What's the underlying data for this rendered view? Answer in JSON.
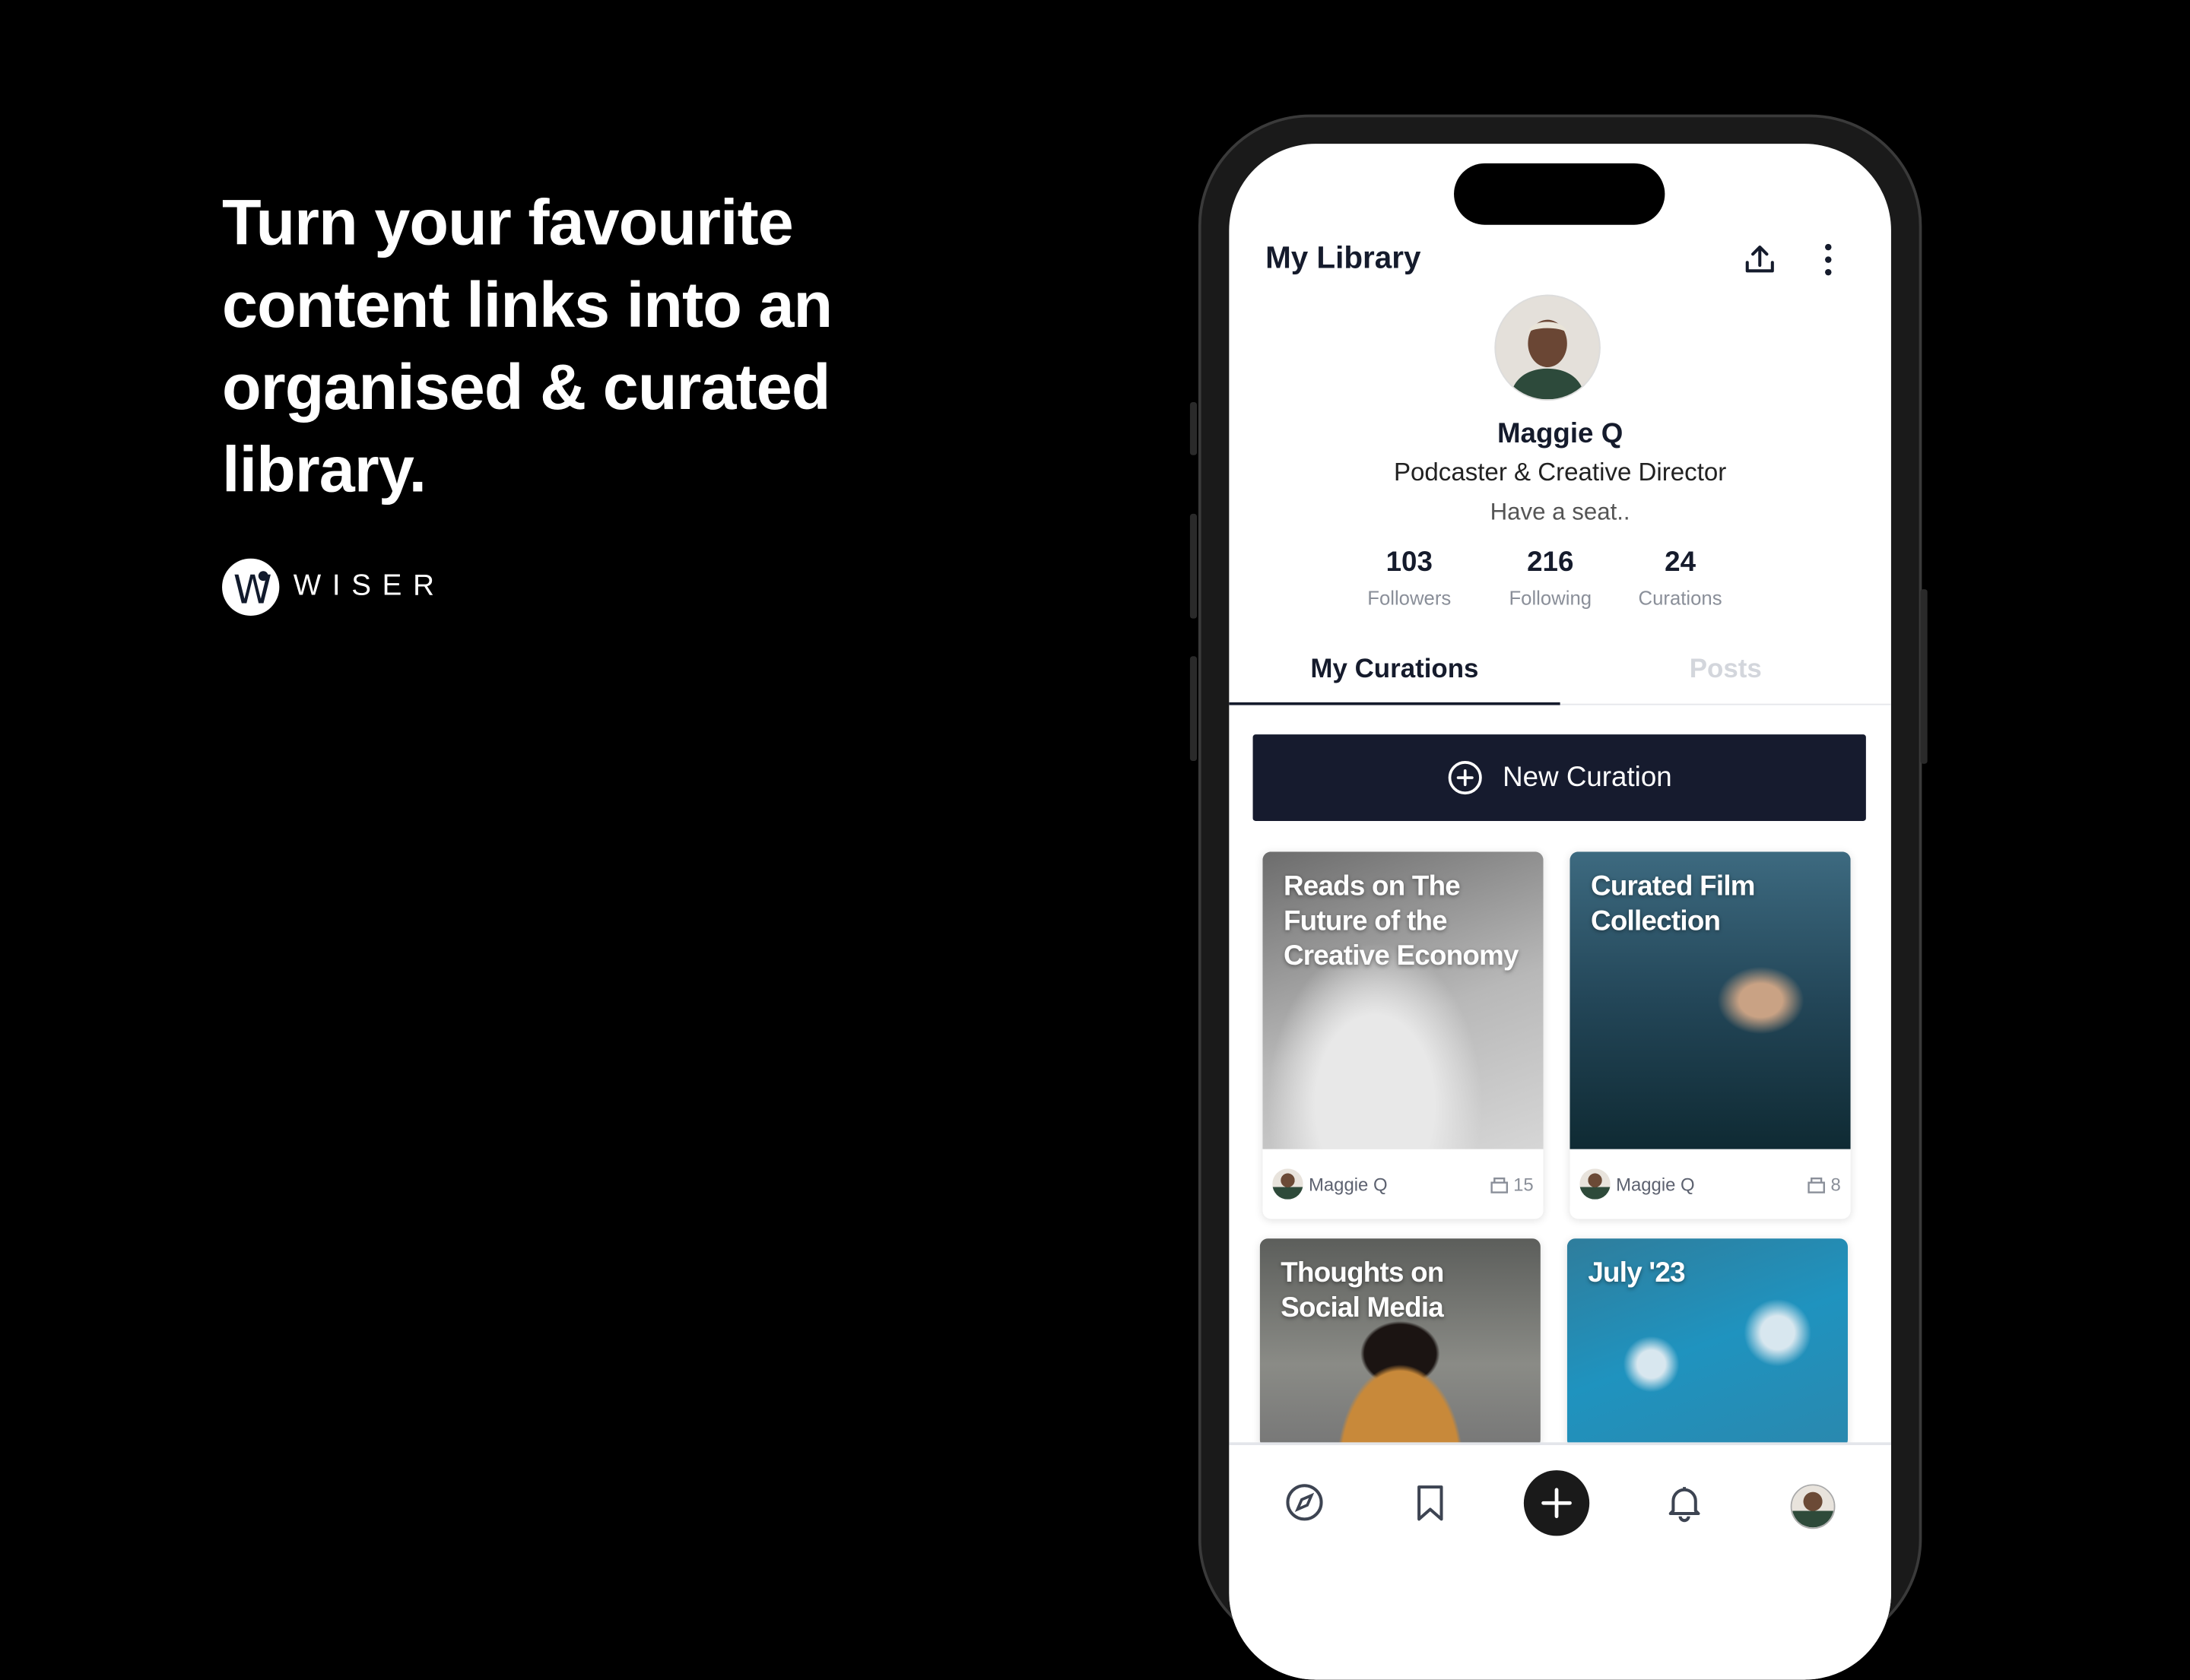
{
  "marketing": {
    "headline": "Turn your favourite content links into an organised & curated library.",
    "logo_text": "WISER"
  },
  "app": {
    "title": "My Library",
    "header_icons": [
      "share-icon",
      "more-vertical-icon"
    ],
    "profile": {
      "name": "Maggie Q",
      "role": "Podcaster & Creative Director",
      "bio": "Have a seat..",
      "stats": [
        {
          "value": "103",
          "label": "Followers"
        },
        {
          "value": "216",
          "label": "Following"
        },
        {
          "value": "24",
          "label": "Curations"
        }
      ]
    },
    "tabs": [
      {
        "label": "My Curations",
        "active": true
      },
      {
        "label": "Posts",
        "active": false
      }
    ],
    "new_curation_label": "New Curation",
    "curations": [
      {
        "title": "Reads on The Future of the Creative Economy",
        "author": "Maggie Q",
        "count": "15"
      },
      {
        "title": "Curated Film Collection",
        "author": "Maggie Q",
        "count": "8"
      },
      {
        "title": "Thoughts on Social Media"
      },
      {
        "title": "July '23"
      }
    ],
    "nav": [
      "compass-icon",
      "bookmark-icon",
      "plus-icon",
      "bell-icon",
      "profile-avatar"
    ]
  }
}
